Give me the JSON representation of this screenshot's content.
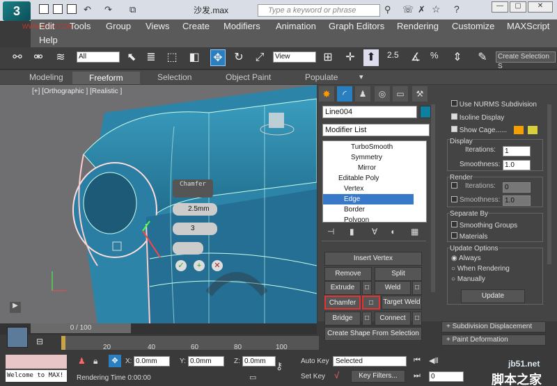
{
  "title": "沙发.max",
  "search_placeholder": "Type a keyword or phrase",
  "watermark": "WWW.3DXY.COM",
  "menu": [
    "Edit",
    "Tools",
    "Group",
    "Views",
    "Create",
    "Modifiers",
    "Animation",
    "Graph Editors",
    "Rendering",
    "Customize",
    "MAXScript",
    "Help"
  ],
  "toolbar": {
    "selection_filter": "All",
    "ref_coord": "View",
    "create_selection": "Create Selection S",
    "snap25": "2.5",
    "pct": "%"
  },
  "ribbon_tabs": [
    "Modeling",
    "Freeform",
    "Selection",
    "Object Paint",
    "Populate"
  ],
  "ribbon_active": "Freeform",
  "viewport_label": "[+] [Orthographic ] [Realistic ]",
  "caddy": {
    "title": "Chamfer",
    "amount": "2.5mm",
    "segments": "3"
  },
  "object_name": "Line004",
  "modifier_list": "Modifier List",
  "stack": [
    "TurboSmooth",
    "Symmetry",
    "Mirror",
    "Editable Poly",
    "Vertex",
    "Edge",
    "Border",
    "Polygon"
  ],
  "stack_selected": "Edge",
  "insert_vertex": "Insert Vertex",
  "buttons": {
    "remove": "Remove",
    "split": "Split",
    "extrude": "Extrude",
    "weld": "Weld",
    "chamfer": "Chamfer",
    "target_weld": "Target Weld",
    "bridge": "Bridge",
    "connect": "Connect",
    "create_shape": "Create Shape From Selection"
  },
  "right": {
    "use_nurms": "Use NURMS Subdivision",
    "isoline": "Isoline Display",
    "show_cage": "Show Cage......",
    "display": "Display",
    "iterations_label": "Iterations:",
    "iterations": "1",
    "smoothness_label": "Smoothness:",
    "smoothness": "1.0",
    "render": "Render",
    "r_iterations": "0",
    "r_smoothness": "1.0",
    "separate_by": "Separate By",
    "smoothing_groups": "Smoothing Groups",
    "materials": "Materials",
    "update_options": "Update Options",
    "always": "Always",
    "when_rendering": "When Rendering",
    "manually": "Manually",
    "update": "Update",
    "subdiv_disp": "Subdivision Displacement",
    "paint_def": "Paint Deformation"
  },
  "timeline": {
    "frame": "0 / 100",
    "ticks": [
      "20",
      "40",
      "60",
      "80",
      "100"
    ],
    "welcome": "Welcome to MAX!",
    "x": "0.0mm",
    "y": "0.0mm",
    "z": "0.0mm",
    "rendering_time": "Rendering Time 0:00:00",
    "auto_key": "Auto Key",
    "set_key": "Set Key",
    "selected": "Selected",
    "key_filters": "Key Filters...",
    "frame_field": "0"
  },
  "corner_watermark": "jb51.net",
  "corner_cn": "脚本之家"
}
